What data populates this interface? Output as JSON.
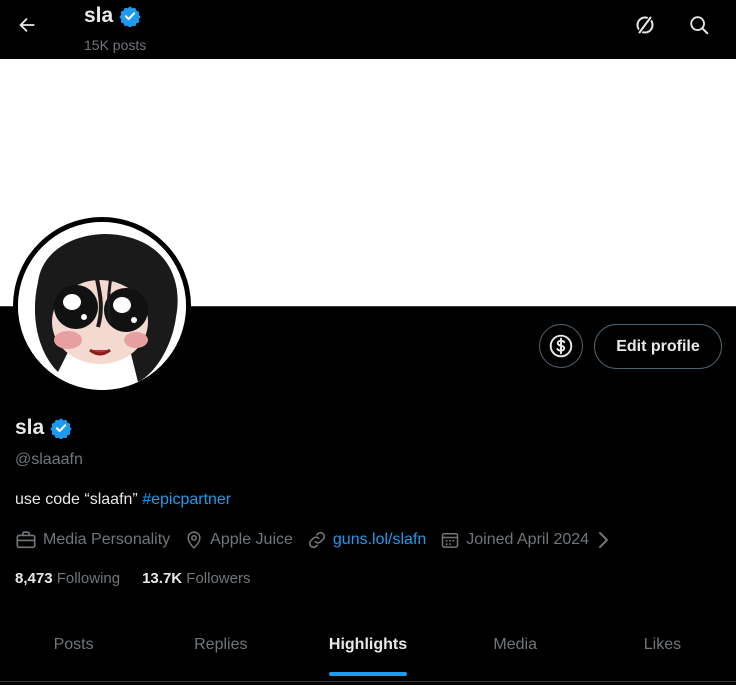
{
  "header": {
    "name": "sla",
    "posts": "15K posts"
  },
  "profile": {
    "name": "sla",
    "handle": "@slaaafn",
    "bio_text": "use code “slaafn” ",
    "bio_hashtag": "#epicpartner",
    "edit_button": "Edit profile",
    "category": "Media Personality",
    "location": "Apple Juice",
    "website": "guns.lol/slafn",
    "joined": "Joined April 2024",
    "following_count": "8,473",
    "following_label": "Following",
    "followers_count": "13.7K",
    "followers_label": "Followers"
  },
  "tabs": [
    {
      "label": "Posts"
    },
    {
      "label": "Replies"
    },
    {
      "label": "Highlights",
      "active": true
    },
    {
      "label": "Media"
    },
    {
      "label": "Likes"
    }
  ],
  "colors": {
    "accent": "#1d9bf0",
    "background": "#000000",
    "banner": "#ffffff",
    "muted_text": "#71767b"
  },
  "icons": [
    "back-arrow-icon",
    "verified-badge-icon",
    "unlink-icon",
    "search-icon",
    "money-icon",
    "briefcase-icon",
    "location-pin-icon",
    "link-icon",
    "calendar-icon",
    "chevron-right-icon"
  ]
}
